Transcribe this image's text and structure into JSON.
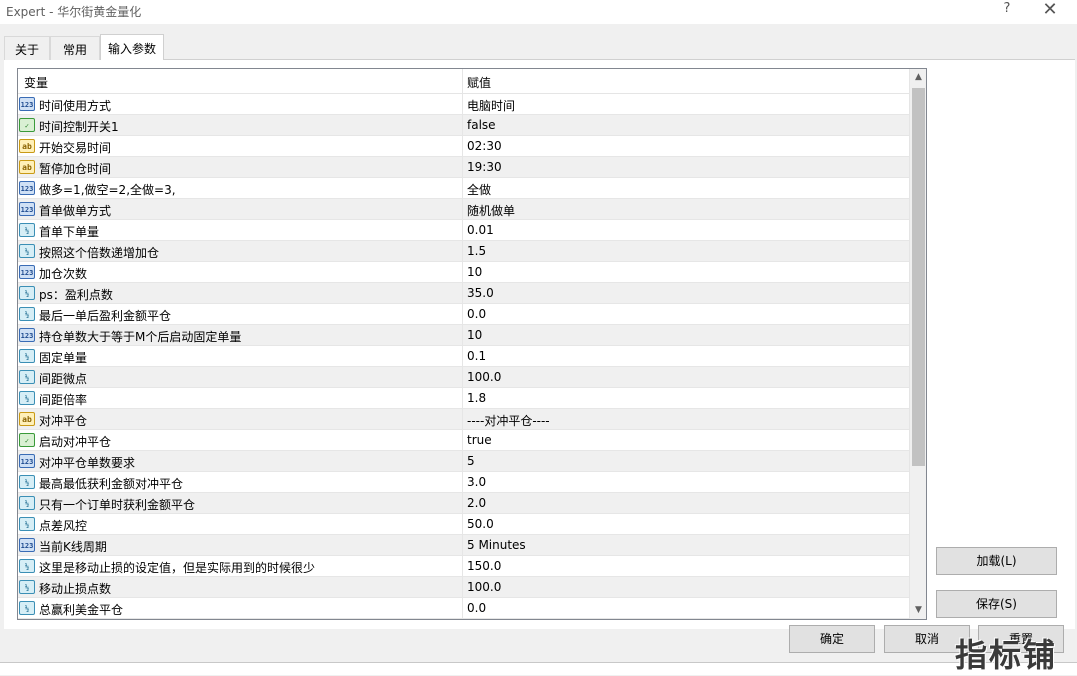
{
  "window": {
    "title": "Expert - 华尔街黄金量化",
    "help_label": "?",
    "close_label": "✕"
  },
  "tabs": [
    {
      "label": "关于"
    },
    {
      "label": "常用"
    },
    {
      "label": "输入参数",
      "active": true
    }
  ],
  "grid": {
    "col_variable": "变量",
    "col_value": "赋值",
    "rows": [
      {
        "type": "int",
        "icon": "123",
        "name": "时间使用方式",
        "value": "电脑时间"
      },
      {
        "type": "bool",
        "icon": "bool",
        "name": "时间控制开关1",
        "value": "false"
      },
      {
        "type": "str",
        "icon": "ab",
        "name": "开始交易时间",
        "value": "02:30"
      },
      {
        "type": "str",
        "icon": "ab",
        "name": "暂停加仓时间",
        "value": "19:30"
      },
      {
        "type": "int",
        "icon": "123",
        "name": "做多=1,做空=2,全做=3,",
        "value": "全做"
      },
      {
        "type": "int",
        "icon": "123",
        "name": "首单做单方式",
        "value": "随机做单"
      },
      {
        "type": "dbl",
        "icon": "½",
        "name": "首单下单量",
        "value": "0.01"
      },
      {
        "type": "dbl",
        "icon": "½",
        "name": "按照这个倍数递增加仓",
        "value": "1.5"
      },
      {
        "type": "int",
        "icon": "123",
        "name": "加仓次数",
        "value": "10"
      },
      {
        "type": "dbl",
        "icon": "½",
        "name": "ps：盈利点数",
        "value": "35.0"
      },
      {
        "type": "dbl",
        "icon": "½",
        "name": "最后一单后盈利金额平仓",
        "value": "0.0"
      },
      {
        "type": "int",
        "icon": "123",
        "name": "持仓单数大于等于M个后启动固定单量",
        "value": "10"
      },
      {
        "type": "dbl",
        "icon": "½",
        "name": "固定单量",
        "value": "0.1"
      },
      {
        "type": "dbl",
        "icon": "½",
        "name": "间距微点",
        "value": "100.0"
      },
      {
        "type": "dbl",
        "icon": "½",
        "name": "间距倍率",
        "value": "1.8"
      },
      {
        "type": "str",
        "icon": "ab",
        "name": "对冲平仓",
        "value": "----对冲平仓----"
      },
      {
        "type": "bool",
        "icon": "bool",
        "name": "启动对冲平仓",
        "value": "true"
      },
      {
        "type": "int",
        "icon": "123",
        "name": "对冲平仓单数要求",
        "value": "5"
      },
      {
        "type": "dbl",
        "icon": "½",
        "name": "最高最低获利金额对冲平仓",
        "value": "3.0"
      },
      {
        "type": "dbl",
        "icon": "½",
        "name": "只有一个订单时获利金额平仓",
        "value": "2.0"
      },
      {
        "type": "dbl",
        "icon": "½",
        "name": "点差风控",
        "value": "50.0"
      },
      {
        "type": "int",
        "icon": "123",
        "name": "当前K线周期",
        "value": "5 Minutes"
      },
      {
        "type": "dbl",
        "icon": "½",
        "name": "这里是移动止损的设定值，但是实际用到的时候很少",
        "value": "150.0"
      },
      {
        "type": "dbl",
        "icon": "½",
        "name": "移动止损点数",
        "value": "100.0"
      },
      {
        "type": "dbl",
        "icon": "½",
        "name": "总赢利美金平仓",
        "value": "0.0"
      }
    ]
  },
  "buttons": {
    "load": "加载(L)",
    "save": "保存(S)",
    "ok": "确定",
    "cancel": "取消",
    "reset": "重置"
  },
  "scrollbar": {
    "up": "▲",
    "down": "▼"
  },
  "watermark": "指标铺"
}
